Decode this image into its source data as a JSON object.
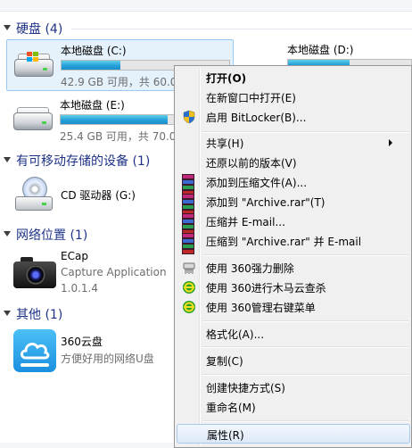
{
  "groups": {
    "hard_disks": "硬盘 (4)",
    "removable": "有可移动存储的设备 (1)",
    "network": "网络位置 (1)",
    "other": "其他 (1)"
  },
  "drives": [
    {
      "name": "本地磁盘 (C:)",
      "info": "42.9 GB 可用，共 60.0",
      "used_fraction": 0.35
    },
    {
      "name": "本地磁盘 (D:)",
      "used_fraction": 0.5
    },
    {
      "name": "本地磁盘 (E:)",
      "info": "25.4 GB 可用，共 70.0",
      "used_fraction": 0.64
    }
  ],
  "cdrom": {
    "name": "CD 驱动器 (G:)"
  },
  "network_item": {
    "name": "ECap",
    "line2": "Capture Application",
    "line3": "1.0.1.4"
  },
  "other_item": {
    "name": "360云盘",
    "line2": "方便好用的网络U盘"
  },
  "context_menu": {
    "items": [
      {
        "label": "打开(O)",
        "bold": true
      },
      {
        "label": "在新窗口中打开(E)"
      },
      {
        "label": "启用 BitLocker(B)...",
        "icon": "shield-icon"
      },
      {
        "label": "共享(H)",
        "submenu": true
      },
      {
        "label": "还原以前的版本(V)"
      },
      {
        "label": "添加到压缩文件(A)...",
        "icon": "winrar-icon"
      },
      {
        "label": "添加到 \"Archive.rar\"(T)",
        "icon": "winrar-icon"
      },
      {
        "label": "压缩并 E-mail...",
        "icon": "winrar-icon"
      },
      {
        "label": "压缩到 \"Archive.rar\" 并 E-mail",
        "icon": "winrar-icon"
      },
      {
        "label": "使用 360强力删除",
        "icon": "shredder-icon"
      },
      {
        "label": "使用 360进行木马云查杀",
        "icon": "360-icon"
      },
      {
        "label": "使用 360管理右键菜单",
        "icon": "360-icon"
      },
      {
        "label": "格式化(A)..."
      },
      {
        "label": "复制(C)"
      },
      {
        "label": "创建快捷方式(S)"
      },
      {
        "label": "重命名(M)"
      },
      {
        "label": "属性(R)",
        "highlighted": true
      }
    ]
  },
  "colors": {
    "accent": "#1e3287",
    "highlight": "#dde9f8",
    "bar": "#26a0da"
  }
}
